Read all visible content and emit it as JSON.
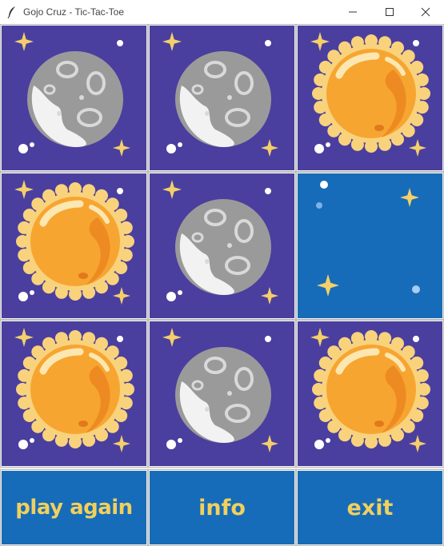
{
  "window": {
    "title": "Gojo Cruz - Tic-Tac-Toe",
    "controls": [
      "minimize",
      "maximize",
      "close"
    ]
  },
  "colors": {
    "cell_purple": "#4a3f9f",
    "cell_empty_blue": "#166cb8",
    "sun": "#f7a531",
    "moon": "#9a9a9a",
    "star": "#f4cf6a",
    "button_text": "#f1d05e"
  },
  "board": {
    "cells": [
      {
        "row": 0,
        "col": 0,
        "piece": "moon"
      },
      {
        "row": 0,
        "col": 1,
        "piece": "moon"
      },
      {
        "row": 0,
        "col": 2,
        "piece": "sun"
      },
      {
        "row": 1,
        "col": 0,
        "piece": "sun"
      },
      {
        "row": 1,
        "col": 1,
        "piece": "moon"
      },
      {
        "row": 1,
        "col": 2,
        "piece": "empty"
      },
      {
        "row": 2,
        "col": 0,
        "piece": "sun"
      },
      {
        "row": 2,
        "col": 1,
        "piece": "moon"
      },
      {
        "row": 2,
        "col": 2,
        "piece": "sun"
      }
    ]
  },
  "buttons": {
    "play_again": "play again",
    "info": "info",
    "exit": "exit"
  }
}
